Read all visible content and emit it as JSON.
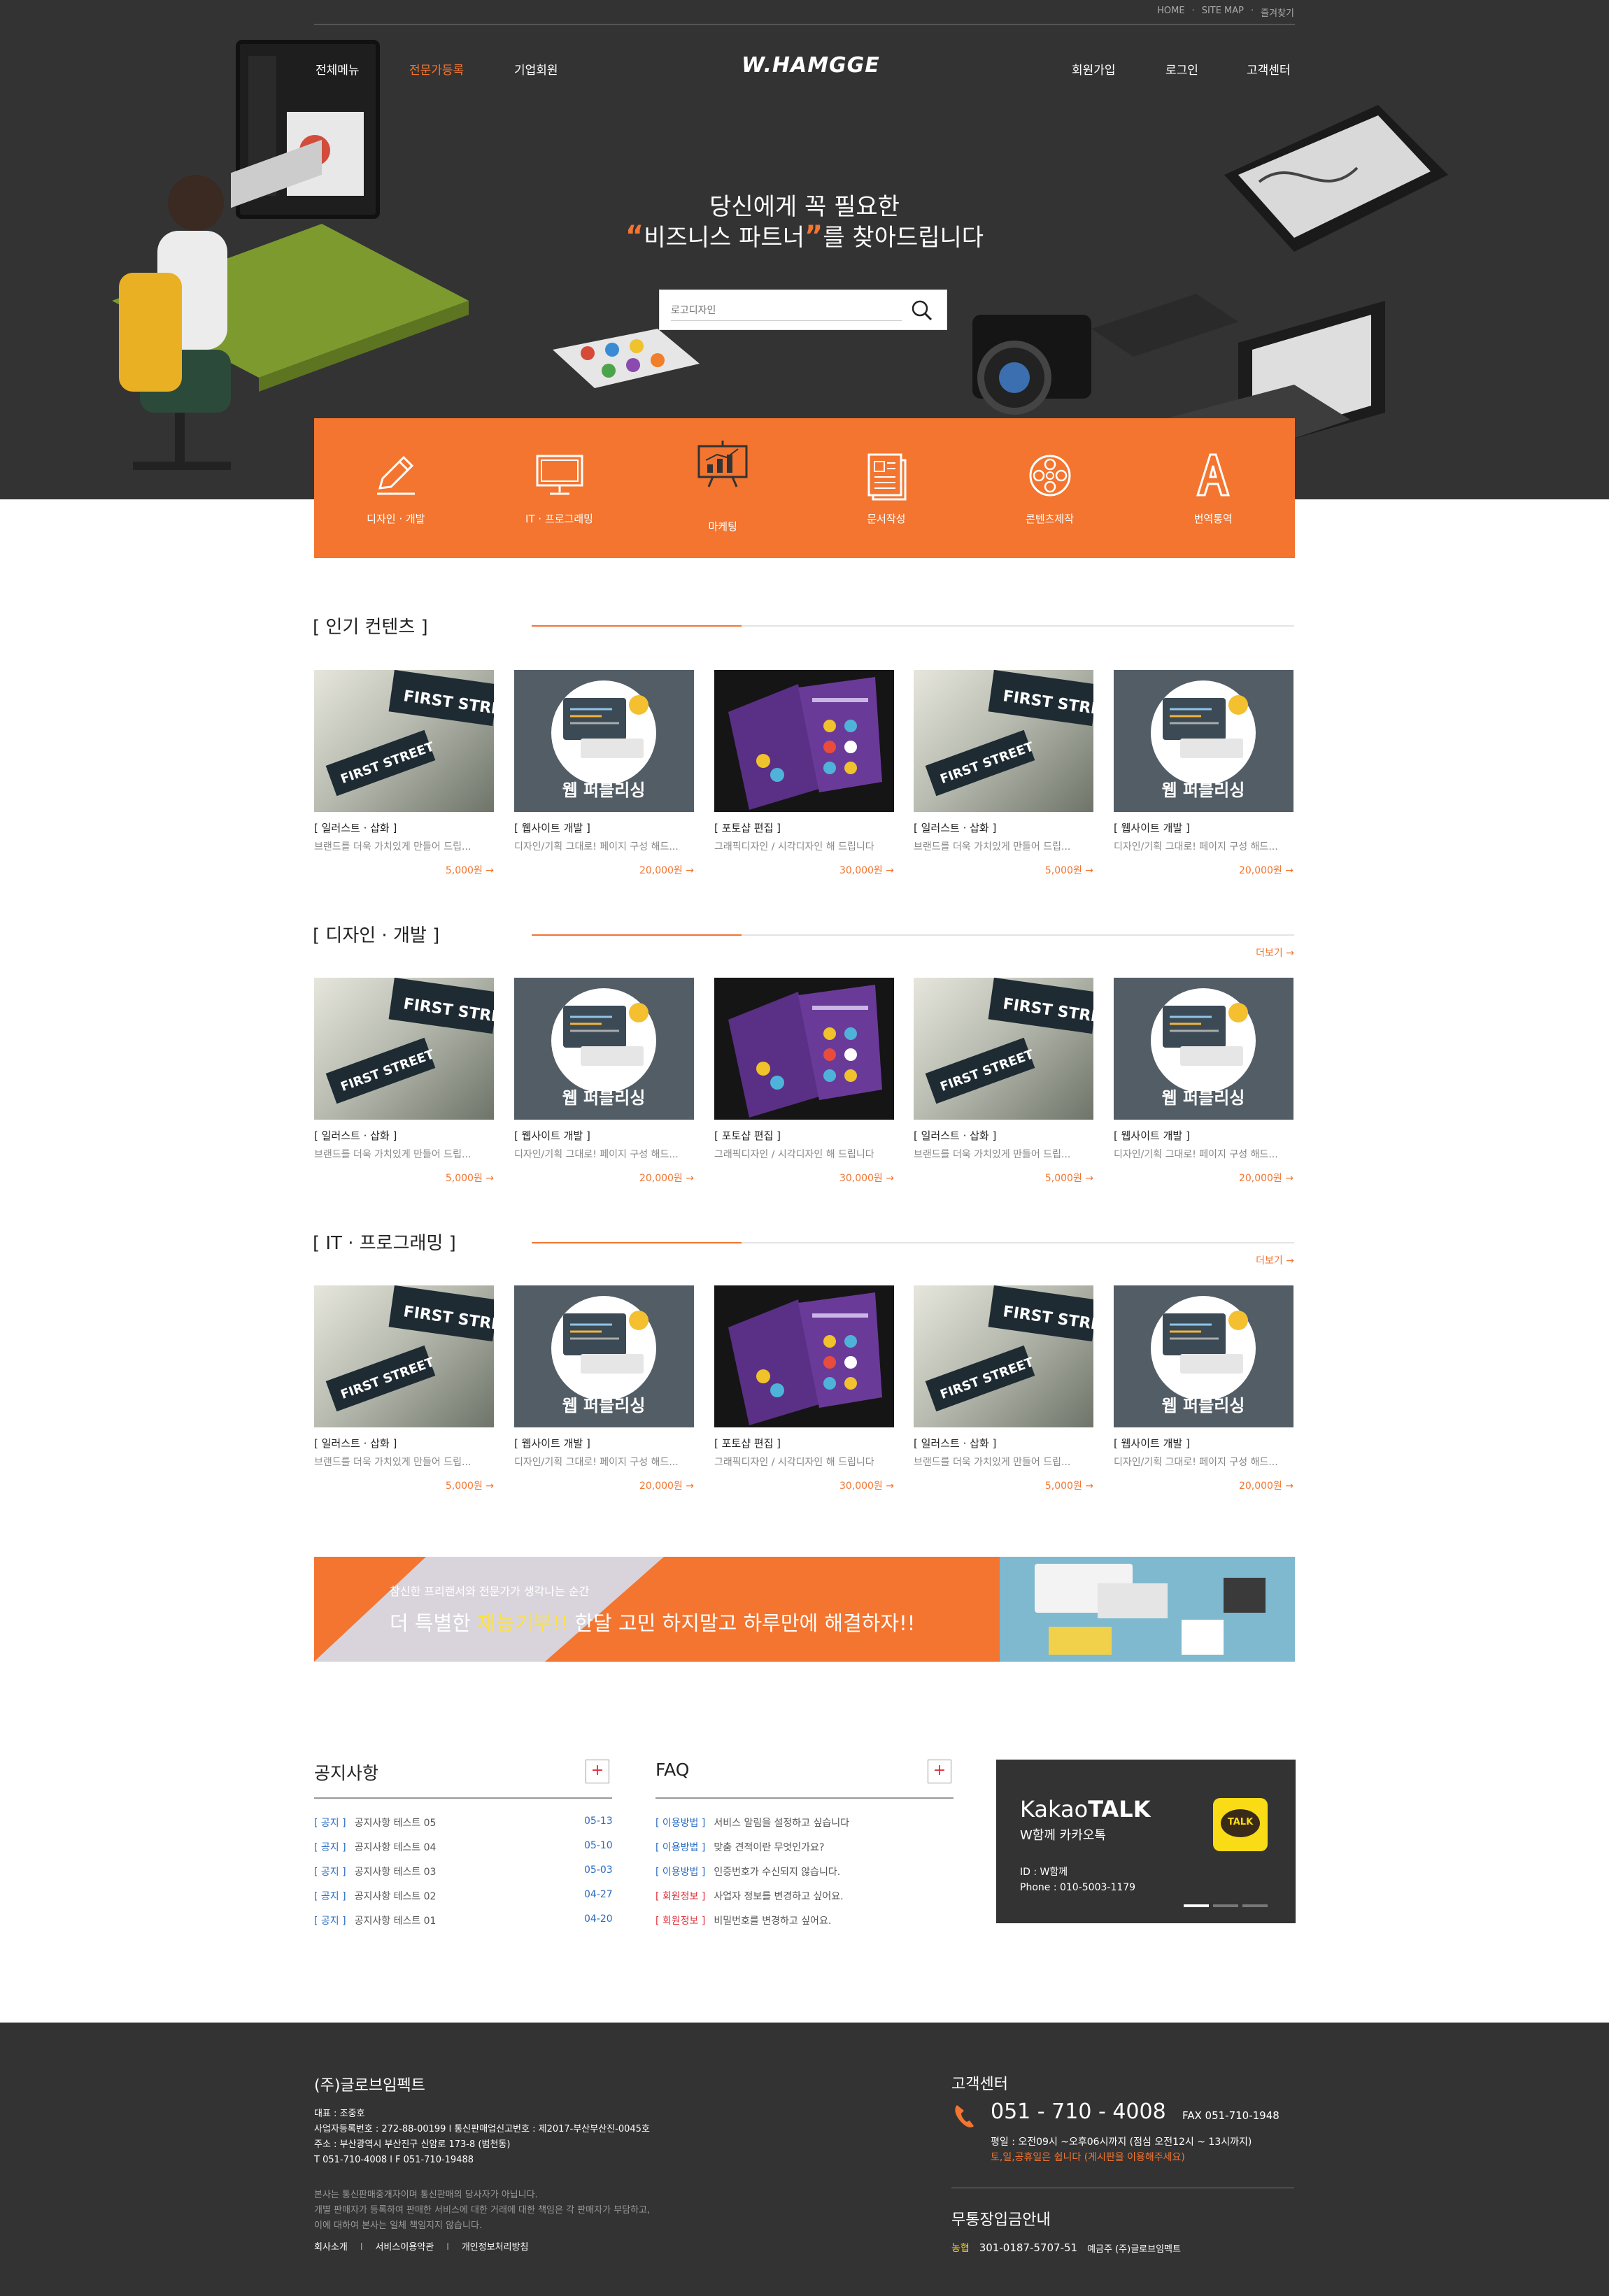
{
  "util_links": [
    "HOME",
    "SITE MAP",
    "즐겨찾기"
  ],
  "nav_left": [
    "전체메뉴",
    "전문가등록",
    "기업회원"
  ],
  "nav_right": [
    "회원가입",
    "로그인",
    "고객센터"
  ],
  "logo": "W.HAMGGE",
  "hero": {
    "line1": "당신에게 꼭 필요한",
    "quote_open": "“",
    "line2_highlight": "비즈니스 파트너",
    "quote_close": "”",
    "line2_rest": "를 찾아드립니다"
  },
  "search": {
    "placeholder": "로고디자인"
  },
  "categories": [
    {
      "label": "디자인 · 개발",
      "icon": "pencil-icon"
    },
    {
      "label": "IT · 프로그래밍",
      "icon": "monitor-icon"
    },
    {
      "label": "마케팅",
      "icon": "chart-board-icon"
    },
    {
      "label": "문서작성",
      "icon": "document-icon"
    },
    {
      "label": "콘텐츠제작",
      "icon": "film-reel-icon"
    },
    {
      "label": "번역통역",
      "icon": "letter-a-icon"
    }
  ],
  "sections": [
    {
      "title": "[ 인기 컨텐츠 ]",
      "more": "",
      "cards": [
        {
          "category": "[ 일러스트 · 삽화 ]",
          "desc": "브랜드를 더욱 가치있게 만들어 드립...",
          "price": "5,000원 →",
          "thumb": "street"
        },
        {
          "category": "[ 웹사이트 개발 ]",
          "desc": "디자인/기획 그대로! 페이지 구성 해드...",
          "price": "20,000원 →",
          "thumb": "web"
        },
        {
          "category": "[ 포토샵 편집 ]",
          "desc": "그래픽디자인 / 시각디자인 해 드립니다",
          "price": "30,000원 →",
          "thumb": "mag"
        },
        {
          "category": "[ 일러스트 · 삽화 ]",
          "desc": "브랜드를 더욱 가치있게 만들어 드립...",
          "price": "5,000원 →",
          "thumb": "street"
        },
        {
          "category": "[ 웹사이트 개발 ]",
          "desc": "디자인/기획 그대로! 페이지 구성 해드...",
          "price": "20,000원 →",
          "thumb": "web"
        }
      ]
    },
    {
      "title": "[ 디자인 · 개발 ]",
      "more": "더보기 →",
      "cards": [
        {
          "category": "[ 일러스트 · 삽화 ]",
          "desc": "브랜드를 더욱 가치있게 만들어 드립...",
          "price": "5,000원 →",
          "thumb": "street"
        },
        {
          "category": "[ 웹사이트 개발 ]",
          "desc": "디자인/기획 그대로! 페이지 구성 해드...",
          "price": "20,000원 →",
          "thumb": "web"
        },
        {
          "category": "[ 포토샵 편집 ]",
          "desc": "그래픽디자인 / 시각디자인 해 드립니다",
          "price": "30,000원 →",
          "thumb": "mag"
        },
        {
          "category": "[ 일러스트 · 삽화 ]",
          "desc": "브랜드를 더욱 가치있게 만들어 드립...",
          "price": "5,000원 →",
          "thumb": "street"
        },
        {
          "category": "[ 웹사이트 개발 ]",
          "desc": "디자인/기획 그대로! 페이지 구성 해드...",
          "price": "20,000원 →",
          "thumb": "web"
        }
      ]
    },
    {
      "title": "[ IT · 프로그래밍 ]",
      "more": "더보기 →",
      "cards": [
        {
          "category": "[ 일러스트 · 삽화 ]",
          "desc": "브랜드를 더욱 가치있게 만들어 드립...",
          "price": "5,000원 →",
          "thumb": "street"
        },
        {
          "category": "[ 웹사이트 개발 ]",
          "desc": "디자인/기획 그대로! 페이지 구성 해드...",
          "price": "20,000원 →",
          "thumb": "web"
        },
        {
          "category": "[ 포토샵 편집 ]",
          "desc": "그래픽디자인 / 시각디자인 해 드립니다",
          "price": "30,000원 →",
          "thumb": "mag"
        },
        {
          "category": "[ 일러스트 · 삽화 ]",
          "desc": "브랜드를 더욱 가치있게 만들어 드립...",
          "price": "5,000원 →",
          "thumb": "street"
        },
        {
          "category": "[ 웹사이트 개발 ]",
          "desc": "디자인/기획 그대로! 페이지 구성 해드...",
          "price": "20,000원 →",
          "thumb": "web"
        }
      ]
    }
  ],
  "thumb_text": {
    "street_sign": "FIRST STREET",
    "web": "웹 퍼블리싱"
  },
  "banner": {
    "sub": "참신한 프리랜서와 전문가가 생각나는 순간",
    "main_pre": "더 특별한 ",
    "main_hl": "재능기부!!",
    "main_post": " 한달 고민 하지말고 하루만에 해결하자!!"
  },
  "notice": {
    "title": "공지사항",
    "plus": "+",
    "rows": [
      {
        "tag": "[ 공지 ]",
        "text": "공지사항 테스트 05",
        "date": "05-13"
      },
      {
        "tag": "[ 공지 ]",
        "text": "공지사항 테스트 04",
        "date": "05-10"
      },
      {
        "tag": "[ 공지 ]",
        "text": "공지사항 테스트 03",
        "date": "05-03"
      },
      {
        "tag": "[ 공지 ]",
        "text": "공지사항 테스트 02",
        "date": "04-27"
      },
      {
        "tag": "[ 공지 ]",
        "text": "공지사항 테스트 01",
        "date": "04-20"
      }
    ]
  },
  "faq": {
    "title": "FAQ",
    "plus": "+",
    "rows": [
      {
        "tag": "[ 이용방법 ]",
        "text": "서비스 알림을 설정하고 싶습니다",
        "red": false
      },
      {
        "tag": "[ 이용방법 ]",
        "text": "맞춤 견적이란 무엇인가요?",
        "red": false
      },
      {
        "tag": "[ 이용방법 ]",
        "text": "인증번호가 수신되지 않습니다.",
        "red": false
      },
      {
        "tag": "[ 회원정보 ]",
        "text": "사업자 정보를 변경하고 싶어요.",
        "red": true
      },
      {
        "tag": "[ 회원정보 ]",
        "text": "비밀번호를 변경하고 싶어요.",
        "red": true
      }
    ]
  },
  "kakao": {
    "title_light": "Kakao",
    "title_bold": "TALK",
    "sub": "W함께 카카오톡",
    "id": "ID : W함께",
    "phone": "Phone : 010-5003-1179",
    "badge": "TALK"
  },
  "footer": {
    "company": "(주)글로브임펙트",
    "info": [
      "대표 : 조중호",
      "사업자등록번호 : 272-88-00199   l   통신판매업신고번호 : 제2017-부산부산진-0045호",
      "주소 : 부산광역시 부산진구 신암로 173-8 (범천동)",
      "T 051-710-4008   l   F 051-710-19488"
    ],
    "note": [
      "본사는 통신판매중개자이며 통신판매의 당사자가 아닙니다.",
      "개별 판매자가 등록하여 판매한 서비스에 대한 거래에 대한 책임은 각 판매자가 부담하고,",
      "이에 대하여 본사는 일체 책임지지 않습니다."
    ],
    "links": [
      "회사소개",
      "서비스이용약관",
      "개인정보처리방침"
    ],
    "cs_title": "고객센터",
    "cs_phone": "051 - 710 - 4008",
    "cs_fax": "FAX 051-710-1948",
    "cs_hours": "평일 : 오전09시 ~오후06시까지 (점심 오전12시 ~ 13시까지)",
    "cs_closed": "토,일,공휴일은 쉽니다 (게시판을 이용해주세요)",
    "bank_title": "무통장입금안내",
    "bank_name": "농협",
    "bank_account": "301-0187-5707-51",
    "bank_holder": "예금주 (주)글로브임펙트"
  },
  "colors": {
    "accent": "#f37530",
    "hero_bg": "#333334",
    "footer_bg": "#333333",
    "link_blue": "#2a6cc4",
    "kakao_yellow": "#f9dc15"
  }
}
